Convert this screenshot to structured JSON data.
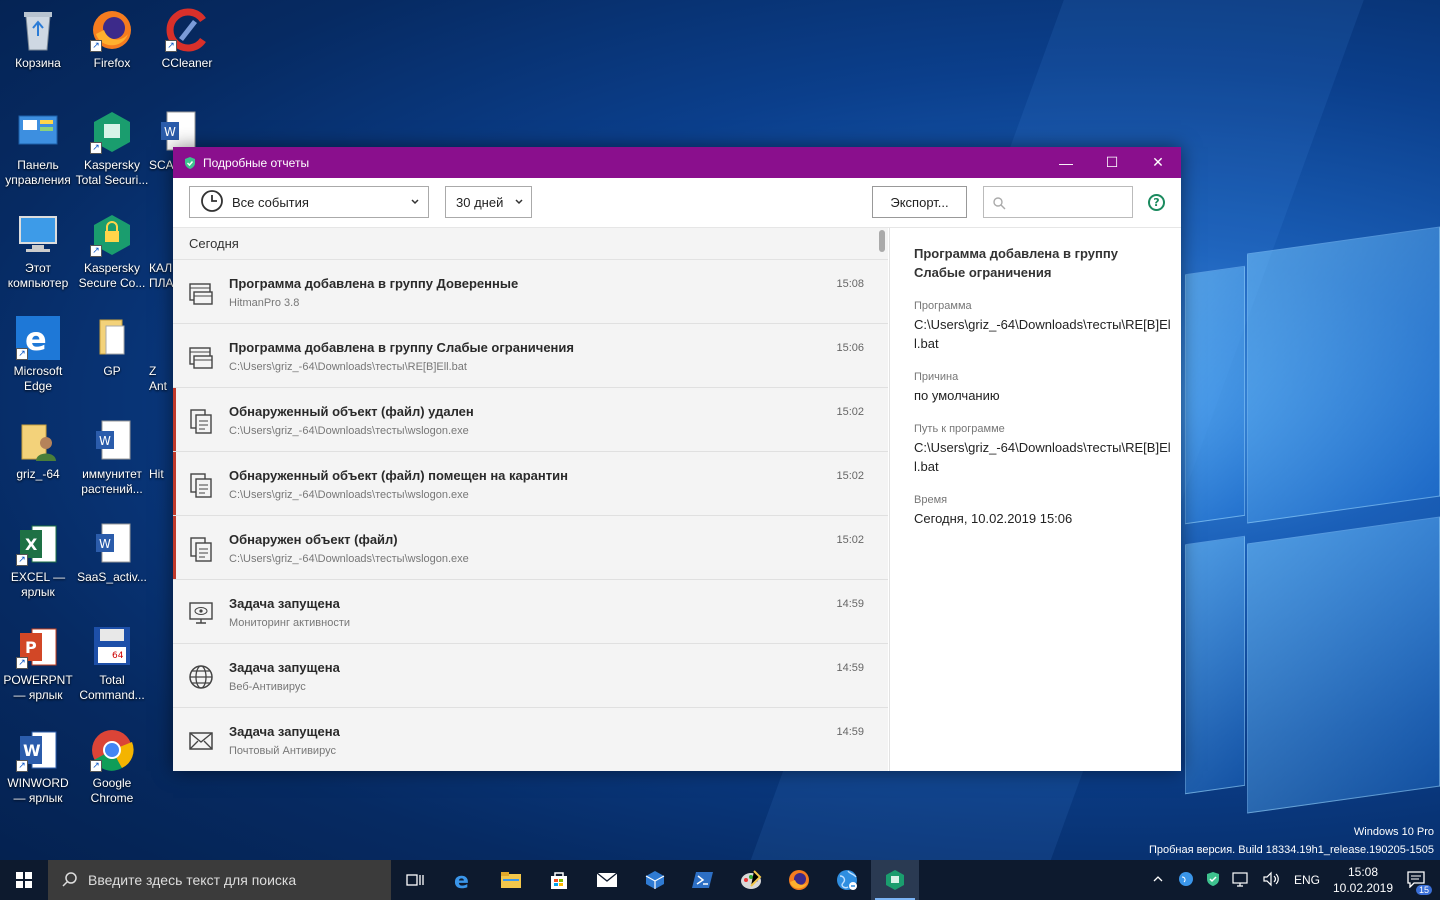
{
  "desktop": {
    "icons": [
      {
        "label": "Корзина"
      },
      {
        "label": "Firefox"
      },
      {
        "label": "CCleaner"
      },
      {
        "label": "Панель управления"
      },
      {
        "label": "Kaspersky Total Securi..."
      },
      {
        "label": "SCA"
      },
      {
        "label": "Этот компьютер"
      },
      {
        "label": "Kaspersky Secure Co..."
      },
      {
        "label": "КАЛ ПЛА"
      },
      {
        "label": "Microsoft Edge"
      },
      {
        "label": "GP"
      },
      {
        "label": "Z Ant"
      },
      {
        "label": "griz_-64"
      },
      {
        "label": "иммунитет растений..."
      },
      {
        "label": "Hit"
      },
      {
        "label": "EXCEL — ярлык"
      },
      {
        "label": "SaaS_activ..."
      },
      {
        "label": "POWERPNT — ярлык"
      },
      {
        "label": "Total Command..."
      },
      {
        "label": "WINWORD — ярлык"
      },
      {
        "label": "Google Chrome"
      }
    ],
    "watermark_line1": "Windows 10 Pro",
    "watermark_line2": "Пробная версия. Build 18334.19h1_release.190205-1505"
  },
  "window": {
    "title": "Подробные отчеты",
    "minimize": "—",
    "maximize": "☐",
    "close": "✕",
    "events_filter": "Все события",
    "period_filter": "30 дней",
    "export_label": "Экспорт...",
    "search_placeholder": "",
    "help": "?"
  },
  "list": {
    "group_label": "Сегодня",
    "rows": [
      {
        "title": "Программа добавлена в группу Доверенные",
        "subtitle": "HitmanPro 3.8",
        "time": "15:08"
      },
      {
        "title": "Программа добавлена в группу Слабые ограничения",
        "subtitle": "C:\\Users\\griz_-64\\Downloads\\тесты\\RE[B]Ell.bat",
        "time": "15:06"
      },
      {
        "title": "Обнаруженный объект (файл) удален",
        "subtitle": "C:\\Users\\griz_-64\\Downloads\\тесты\\wslogon.exe",
        "time": "15:02"
      },
      {
        "title": "Обнаруженный объект (файл) помещен на карантин",
        "subtitle": "C:\\Users\\griz_-64\\Downloads\\тесты\\wslogon.exe",
        "time": "15:02"
      },
      {
        "title": "Обнаружен объект (файл)",
        "subtitle": "C:\\Users\\griz_-64\\Downloads\\тесты\\wslogon.exe",
        "time": "15:02"
      },
      {
        "title": "Задача запущена",
        "subtitle": "Мониторинг активности",
        "time": "14:59"
      },
      {
        "title": "Задача запущена",
        "subtitle": "Веб-Антивирус",
        "time": "14:59"
      },
      {
        "title": "Задача запущена",
        "subtitle": "Почтовый Антивирус",
        "time": "14:59"
      }
    ]
  },
  "detail": {
    "title": "Программа добавлена в группу Слабые ограничения",
    "program_label": "Программа",
    "program_value": "C:\\Users\\griz_-64\\Downloads\\тесты\\RE[B]Ell.bat",
    "reason_label": "Причина",
    "reason_value": "по умолчанию",
    "path_label": "Путь к программе",
    "path_value": "C:\\Users\\griz_-64\\Downloads\\тесты\\RE[B]Ell.bat",
    "time_label": "Время",
    "time_value": "Сегодня, 10.02.2019 15:06"
  },
  "taskbar": {
    "search_placeholder": "Введите здесь текст для поиска",
    "lang": "ENG",
    "time": "15:08",
    "date": "10.02.2019",
    "notifications": "15"
  },
  "colors": {
    "titlebar": "#8a0f8d",
    "kaspersky_green": "#1a8a5e",
    "alert_red": "#c0392b"
  }
}
